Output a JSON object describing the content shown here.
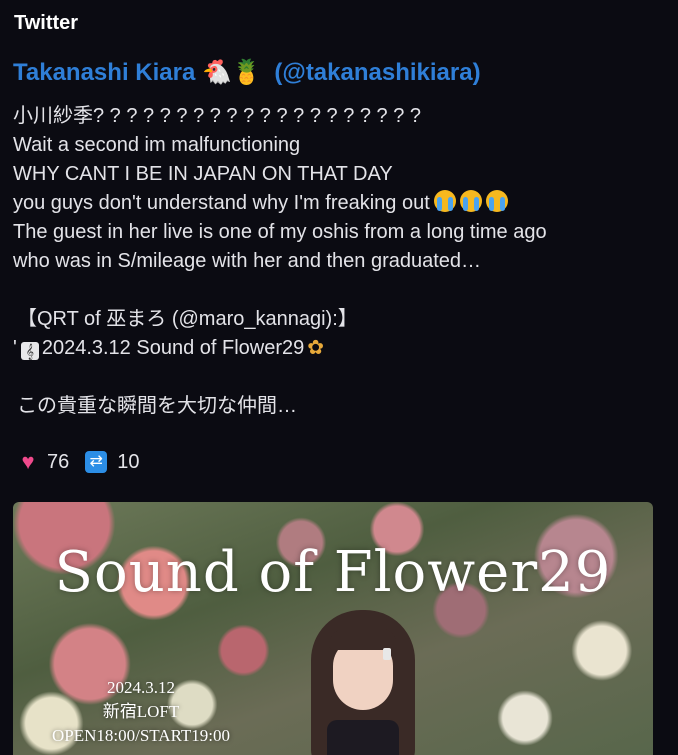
{
  "embed": {
    "provider": "Twitter",
    "author_name": "Takanashi Kiara",
    "author_emoji": "🐔🍍",
    "author_handle": "(@takanashikiara)",
    "lines": [
      "小川紗季? ? ? ? ? ? ? ? ? ? ? ? ? ? ? ? ? ? ? ?",
      "Wait a second im malfunctioning",
      "WHY CANT I BE IN JAPAN ON THAT DAY",
      "you guys don't understand why I'm freaking out",
      "The guest in her live is one of my oshis from a long time ago",
      "who was in S/mileage with her and then graduated…"
    ],
    "qrt_label": "【QRT of 巫まろ (@maro_kannagi):】",
    "qrt_prefix": "'",
    "qrt_line": "2024.3.12 Sound of Flower29",
    "qrt_snippet": "この貴重な瞬間を大切な仲間…",
    "likes": "76",
    "retweets": "10",
    "icons": {
      "heart": "sparkling-heart-icon",
      "retweet": "retweet-icon",
      "crying": "loudly-crying-face-icon",
      "music": "music-score-icon",
      "flower": "bouquet-icon"
    },
    "colors": {
      "background": "#0b0b12",
      "author": "#2f7fd8",
      "text": "#e3e3e8",
      "retweet": "#2c8ee6",
      "heart": "#f04a8c"
    }
  },
  "poster": {
    "title": "Sound of Flower29",
    "date": "2024.3.12",
    "venue": "新宿LOFT",
    "time": "OPEN18:00/START19:00"
  }
}
